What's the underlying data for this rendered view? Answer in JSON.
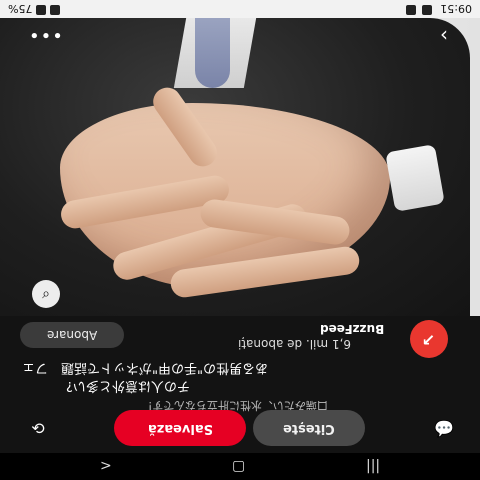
{
  "status": {
    "time": "09:51",
    "battery": "75%"
  },
  "photo": {
    "icons": {
      "more": "more-icon",
      "back": "back-icon",
      "scan": "lens-icon"
    }
  },
  "creator": {
    "name": "BuzzFeed",
    "followers": "6,1 mil. de abonați",
    "follow_label": "Abonare"
  },
  "pin": {
    "title_line1": "ある男性の\"手の甲\"がネットで話題　フェ",
    "title_line2": "チの人は意外と多い?",
    "description": "口端みたい、水性に肝立ちなんです!"
  },
  "actions": {
    "share_icon": "share-icon",
    "save_label": "Salvează",
    "read_label": "Citește",
    "comment_icon": "comment-icon"
  },
  "nav": {
    "back": "back-nav",
    "home": "home-nav",
    "recents": "recents-nav"
  },
  "colors": {
    "accent": "#e60023",
    "panel": "#131313"
  }
}
